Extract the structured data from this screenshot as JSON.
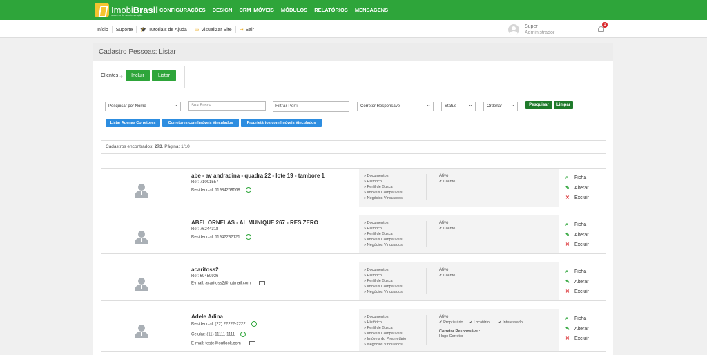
{
  "brand": {
    "name_light": "Imobi",
    "name_bold": "Brasil",
    "tagline": "sistema de administração"
  },
  "top_nav": [
    "CONFIGURAÇÕES",
    "DESIGN",
    "CRM IMÓVEIS",
    "MÓDULOS",
    "RELATÓRIOS",
    "MENSAGENS"
  ],
  "sub_nav": {
    "inicio": "Início",
    "suporte": "Suporte",
    "tutoriais": "Tutoriais de Ajuda",
    "visualizar": "Visualizar Site",
    "sair": "Sair"
  },
  "user": {
    "name": "Super",
    "role": "Administrador"
  },
  "notifications": "1",
  "page_title": "Cadastro Pessoas: Listar",
  "tabs": {
    "label": "Clientes",
    "incluir": "Incluir",
    "listar": "Listar"
  },
  "filters": {
    "pesquisar_por": "Pesquisar por Nome",
    "busca_placeholder": "Sua Busca",
    "perfil_placeholder": "Filtrar Perfil",
    "corretor": "Corretor Responsável",
    "status": "Status",
    "ordenar": "Ordenar",
    "pesquisar_btn": "Pesquisar",
    "limpar_btn": "Limpar",
    "quick": [
      "Listar Apenas Corretores",
      "Corretores com Imóveis Vinculados",
      "Proprietários com Imóveis Vinculados"
    ]
  },
  "summary": {
    "prefix": "Cadastros encontrados:",
    "count": "273",
    "page": ". Página: 1/10"
  },
  "actions": {
    "ficha": "Ficha",
    "alterar": "Alterar",
    "excluir": "Excluir"
  },
  "records": [
    {
      "name": "abe - av andradina - quadra 22 - lote 19 - tambore 1",
      "lines": [
        "Ref: 71001557",
        "Residencial: 11984269568"
      ],
      "links": [
        "Documentos",
        "Histórico",
        "Perfil de Busca",
        "Imóveis Compatíveis",
        "Negócios Vinculados"
      ],
      "status": "Ativo",
      "tags": [
        "Cliente"
      ]
    },
    {
      "name": "ABEL ORNELAS - AL MUNIQUE 267 - RES ZERO",
      "lines": [
        "Ref: 76244318",
        "Residencial: 11942232121"
      ],
      "links": [
        "Documentos",
        "Histórico",
        "Perfil de Busca",
        "Imóveis Compatíveis",
        "Negócios Vinculados"
      ],
      "status": "Ativo",
      "tags": [
        "Cliente"
      ]
    },
    {
      "name": "acaritoss2",
      "lines": [
        "Ref: 69459936",
        "E-mail:  acaritoss2@hotmail.com"
      ],
      "links": [
        "Documentos",
        "Histórico",
        "Perfil de Busca",
        "Imóveis Compatíveis",
        "Negócios Vinculados"
      ],
      "status": "Ativo",
      "tags": [
        "Cliente"
      ]
    },
    {
      "name": "Adele Adina",
      "lines": [
        "Residencial: (22) 22222-2222",
        "Celular: (11) 11111-1111",
        "E-mail:  teste@outlook.com"
      ],
      "links": [
        "Documentos",
        "Histórico",
        "Perfil de Busca",
        "Imóveis Compatíveis",
        "Imóveis do Proprietário",
        "Negócios Vinculados"
      ],
      "status": "Ativo",
      "tags": [
        "Proprietário",
        "Locatário",
        "Interessado"
      ],
      "corretor_label": "Corretor Responsável:",
      "corretor": "Hugo Corretor"
    }
  ]
}
